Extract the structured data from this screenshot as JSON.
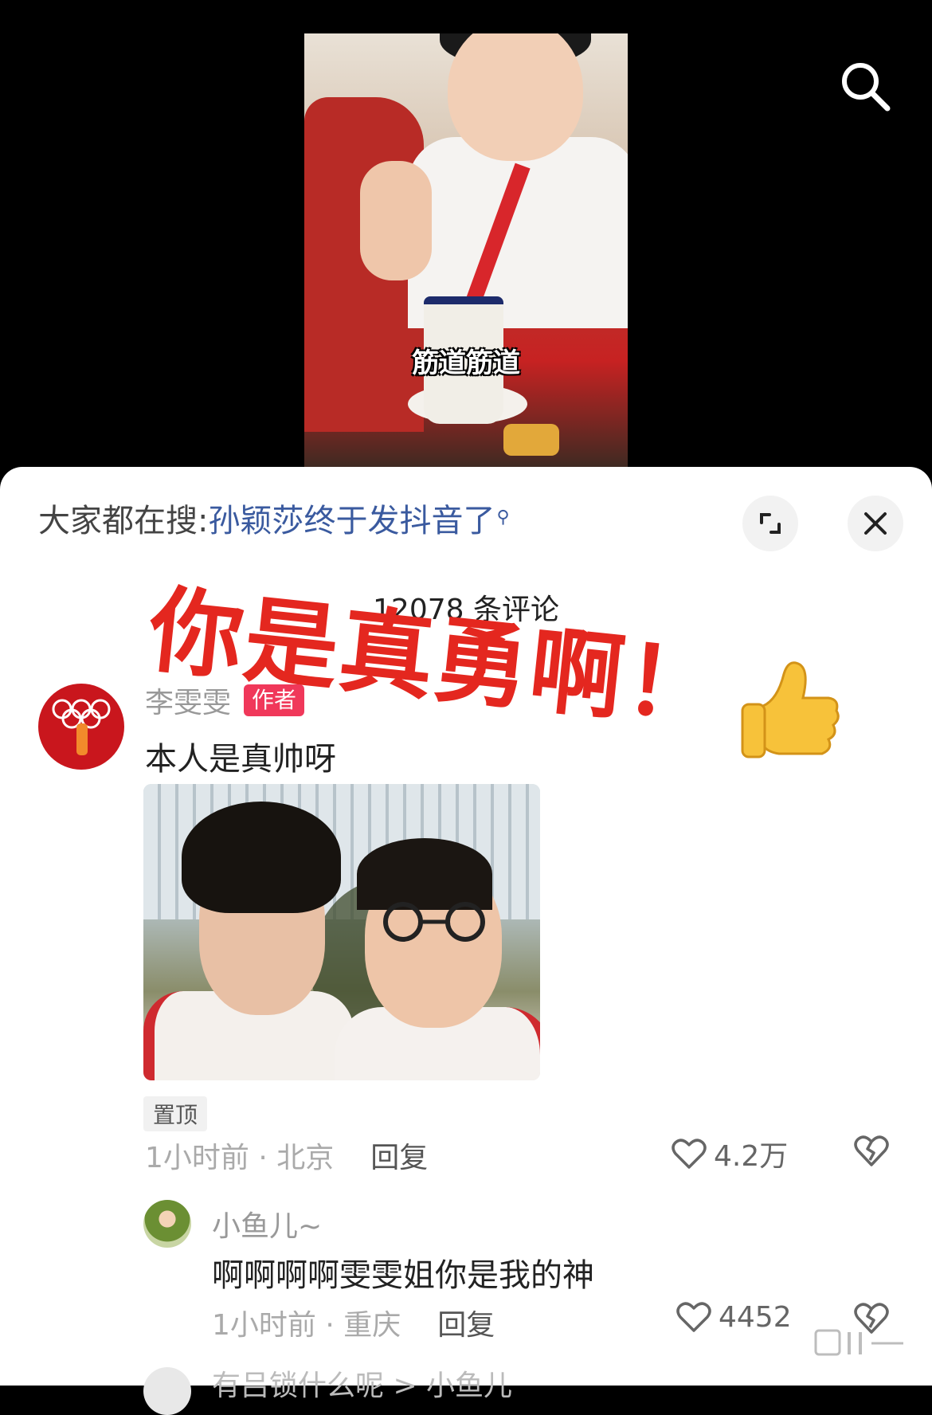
{
  "video": {
    "caption": "筋道筋道"
  },
  "header": {
    "search_icon": "search-icon"
  },
  "panel": {
    "hot_search_prefix": "大家都在搜:",
    "hot_search_link": "孙颖莎终于发抖音了",
    "hot_search_icon": "search-icon",
    "expand_icon": "expand-icon",
    "close_icon": "close-icon",
    "comment_count": "12078 条评论",
    "overlay_text": "你是真勇啊！",
    "overlay_emoji": "thumbs-up-emoji"
  },
  "comments": [
    {
      "name": "李雯雯",
      "tag": "作者",
      "text": "本人是真帅呀",
      "pinned": "置顶",
      "time_location": "1小时前 · 北京",
      "reply": "回复",
      "likes": "4.2万"
    },
    {
      "name": "小鱼儿~",
      "text": "啊啊啊啊雯雯姐你是我的神",
      "time_location": "1小时前 · 重庆",
      "reply": "回复",
      "likes": "4452"
    },
    {
      "text": "有吕锁什么呢 > 小鱼儿"
    }
  ],
  "colors": {
    "author_tag": "#f0385a",
    "overlay_red": "#e4271f",
    "link_blue": "#3a5a9f"
  }
}
